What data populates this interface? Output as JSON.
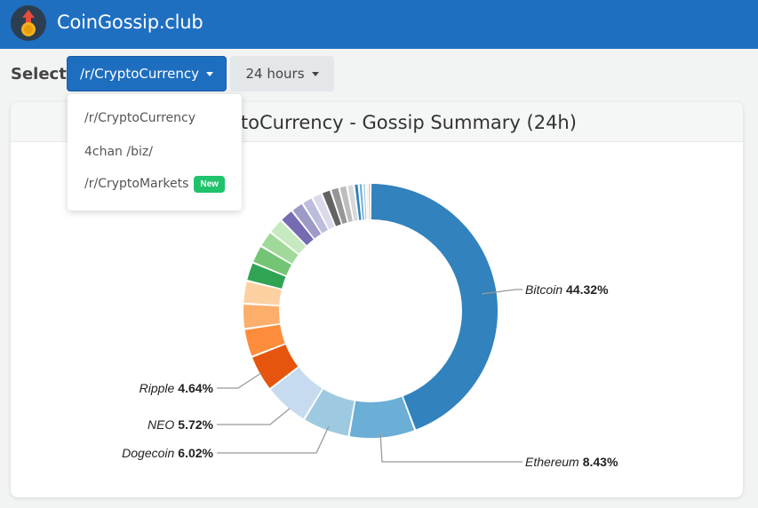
{
  "app": {
    "title": "CoinGossip.club"
  },
  "controls": {
    "select_label": "Select:",
    "subreddit": "/r/CryptoCurrency",
    "timeframe": "24 hours"
  },
  "dropdown": {
    "items": [
      {
        "label": "/r/CryptoCurrency"
      },
      {
        "label": "4chan /biz/"
      },
      {
        "label": "/r/CryptoMarkets",
        "badge": "New"
      }
    ]
  },
  "card": {
    "title": "/r/CryptoCurrency - Gossip Summary (24h)"
  },
  "colors": {
    "navbar": "#1f6fc1",
    "accent_button": "#1e6ec0",
    "badge": "#20c36b"
  },
  "chart_data": {
    "type": "pie",
    "donut": true,
    "labels": [
      {
        "name": "Bitcoin",
        "value": "44.32%"
      },
      {
        "name": "Ethereum",
        "value": "8.43%"
      },
      {
        "name": "Dogecoin",
        "value": "6.02%"
      },
      {
        "name": "NEO",
        "value": "5.72%"
      },
      {
        "name": "Ripple",
        "value": "4.64%"
      }
    ],
    "slices": [
      {
        "value": 44.32,
        "color": "#3182bd"
      },
      {
        "value": 8.43,
        "color": "#6baed6"
      },
      {
        "value": 6.02,
        "color": "#9ecae1"
      },
      {
        "value": 5.72,
        "color": "#c6dbef"
      },
      {
        "value": 4.64,
        "color": "#e6550d"
      },
      {
        "value": 3.6,
        "color": "#fd8d3c"
      },
      {
        "value": 3.2,
        "color": "#fdae6b"
      },
      {
        "value": 2.9,
        "color": "#fdd0a2"
      },
      {
        "value": 2.4,
        "color": "#31a354"
      },
      {
        "value": 2.3,
        "color": "#74c476"
      },
      {
        "value": 2.1,
        "color": "#a1d99b"
      },
      {
        "value": 2.0,
        "color": "#c7e9c0"
      },
      {
        "value": 1.8,
        "color": "#756bb1"
      },
      {
        "value": 1.6,
        "color": "#9e9ac8"
      },
      {
        "value": 1.4,
        "color": "#bcbddc"
      },
      {
        "value": 1.3,
        "color": "#dadaeb"
      },
      {
        "value": 1.2,
        "color": "#636363"
      },
      {
        "value": 1.1,
        "color": "#969696"
      },
      {
        "value": 1.0,
        "color": "#bdbdbd"
      },
      {
        "value": 0.9,
        "color": "#d9d9d9"
      },
      {
        "value": 0.6,
        "color": "#3182bd"
      },
      {
        "value": 0.5,
        "color": "#6baed6"
      },
      {
        "value": 0.4,
        "color": "#9ecae1"
      },
      {
        "value": 0.3,
        "color": "#c6dbef"
      },
      {
        "value": 0.3,
        "color": "#e6550d"
      }
    ]
  }
}
